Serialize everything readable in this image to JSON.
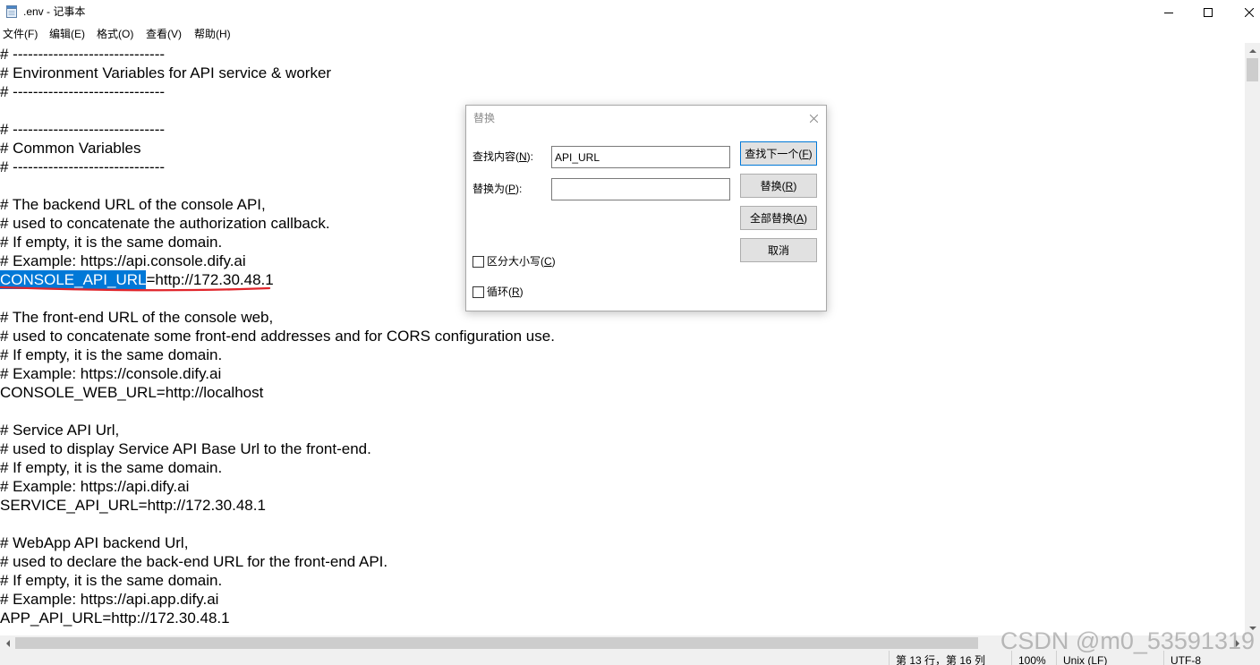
{
  "window": {
    "title": ".env - 记事本"
  },
  "icons": {
    "app": "notepad-icon",
    "minimize": "minimize-icon",
    "maximize": "maximize-icon",
    "close": "close-icon",
    "scroll_up": "arrow-up-icon",
    "scroll_down": "arrow-down-icon",
    "scroll_left": "arrow-left-icon",
    "scroll_right": "arrow-right-icon"
  },
  "colors": {
    "selection": "#0078d7",
    "annotation": "#e0252b",
    "default_button_border": "#0078d7"
  },
  "menu": {
    "items": [
      {
        "label": "文件(F)"
      },
      {
        "label": "编辑(E)"
      },
      {
        "label": "格式(O)"
      },
      {
        "label": "查看(V)"
      },
      {
        "label": "帮助(H)"
      }
    ]
  },
  "editor": {
    "lines": [
      {
        "text": "# ------------------------------"
      },
      {
        "text": "# Environment Variables for API service & worker"
      },
      {
        "text": "# ------------------------------"
      },
      {
        "text": ""
      },
      {
        "text": "# ------------------------------"
      },
      {
        "text": "# Common Variables"
      },
      {
        "text": "# ------------------------------"
      },
      {
        "text": ""
      },
      {
        "text": "# The backend URL of the console API,"
      },
      {
        "text": "# used to concatenate the authorization callback."
      },
      {
        "text": "# If empty, it is the same domain."
      },
      {
        "text": "# Example: https://api.console.dify.ai"
      },
      {
        "selected": "CONSOLE_API_URL",
        "text": "=http://172.30.48.1"
      },
      {
        "text": ""
      },
      {
        "text": "# The front-end URL of the console web,"
      },
      {
        "text": "# used to concatenate some front-end addresses and for CORS configuration use."
      },
      {
        "text": "# If empty, it is the same domain."
      },
      {
        "text": "# Example: https://console.dify.ai"
      },
      {
        "text": "CONSOLE_WEB_URL=http://localhost"
      },
      {
        "text": ""
      },
      {
        "text": "# Service API Url,"
      },
      {
        "text": "# used to display Service API Base Url to the front-end."
      },
      {
        "text": "# If empty, it is the same domain."
      },
      {
        "text": "# Example: https://api.dify.ai"
      },
      {
        "text": "SERVICE_API_URL=http://172.30.48.1"
      },
      {
        "text": ""
      },
      {
        "text": "# WebApp API backend Url,"
      },
      {
        "text": "# used to declare the back-end URL for the front-end API."
      },
      {
        "text": "# If empty, it is the same domain."
      },
      {
        "text": "# Example: https://api.app.dify.ai"
      },
      {
        "text": "APP_API_URL=http://172.30.48.1"
      }
    ]
  },
  "replace_dialog": {
    "title": "替换",
    "find_label": "查找内容(N):",
    "find_value": "API_URL",
    "replace_label": "替换为(P):",
    "replace_value": "",
    "buttons": {
      "find_next": "查找下一个(F)",
      "replace": "替换(R)",
      "replace_all": "全部替换(A)",
      "cancel": "取消"
    },
    "match_case": {
      "label": "区分大小写(C)",
      "checked": false
    },
    "wrap_around": {
      "label": "循环(R)",
      "checked": false
    }
  },
  "status_bar": {
    "position": "第 13 行，第 16 列",
    "zoom": "100%",
    "line_ending": "Unix (LF)",
    "encoding": "UTF-8"
  },
  "watermark": "CSDN @m0_53591319"
}
